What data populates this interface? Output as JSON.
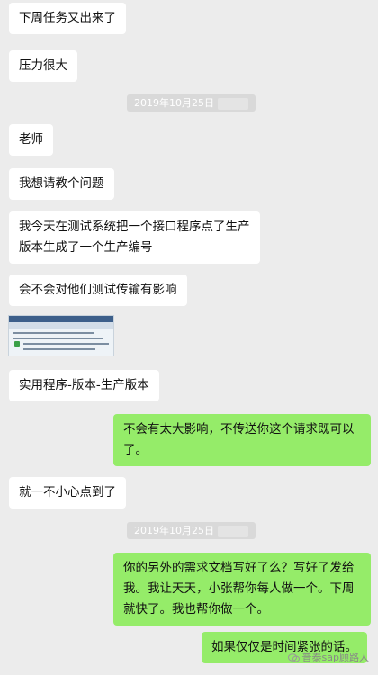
{
  "messages": [
    "下周任务又出来了",
    "压力很大",
    "老师",
    "我想请教个问题",
    "我今天在测试系统把一个接口程序点了生产\n版本生成了一个生产编号",
    "会不会对他们测试传输有影响",
    "实用程序-版本-生产版本",
    "不会有太大影响，不传送你这个请求既可以了。",
    "就一不小心点到了",
    "你的另外的需求文档写好了么？写好了发给我。我让天天，小张帮你每人做一个。下周就快了。我也帮你做一个。",
    "如果仅仅是时间紧张的话。"
  ],
  "timestamps": [
    "2019年10月25日",
    "2019年10月25日"
  ],
  "watermark": "普泰sap顾路人",
  "colors": {
    "background": "#ececec",
    "incoming": "#ffffff",
    "outgoing": "#95ec69"
  }
}
